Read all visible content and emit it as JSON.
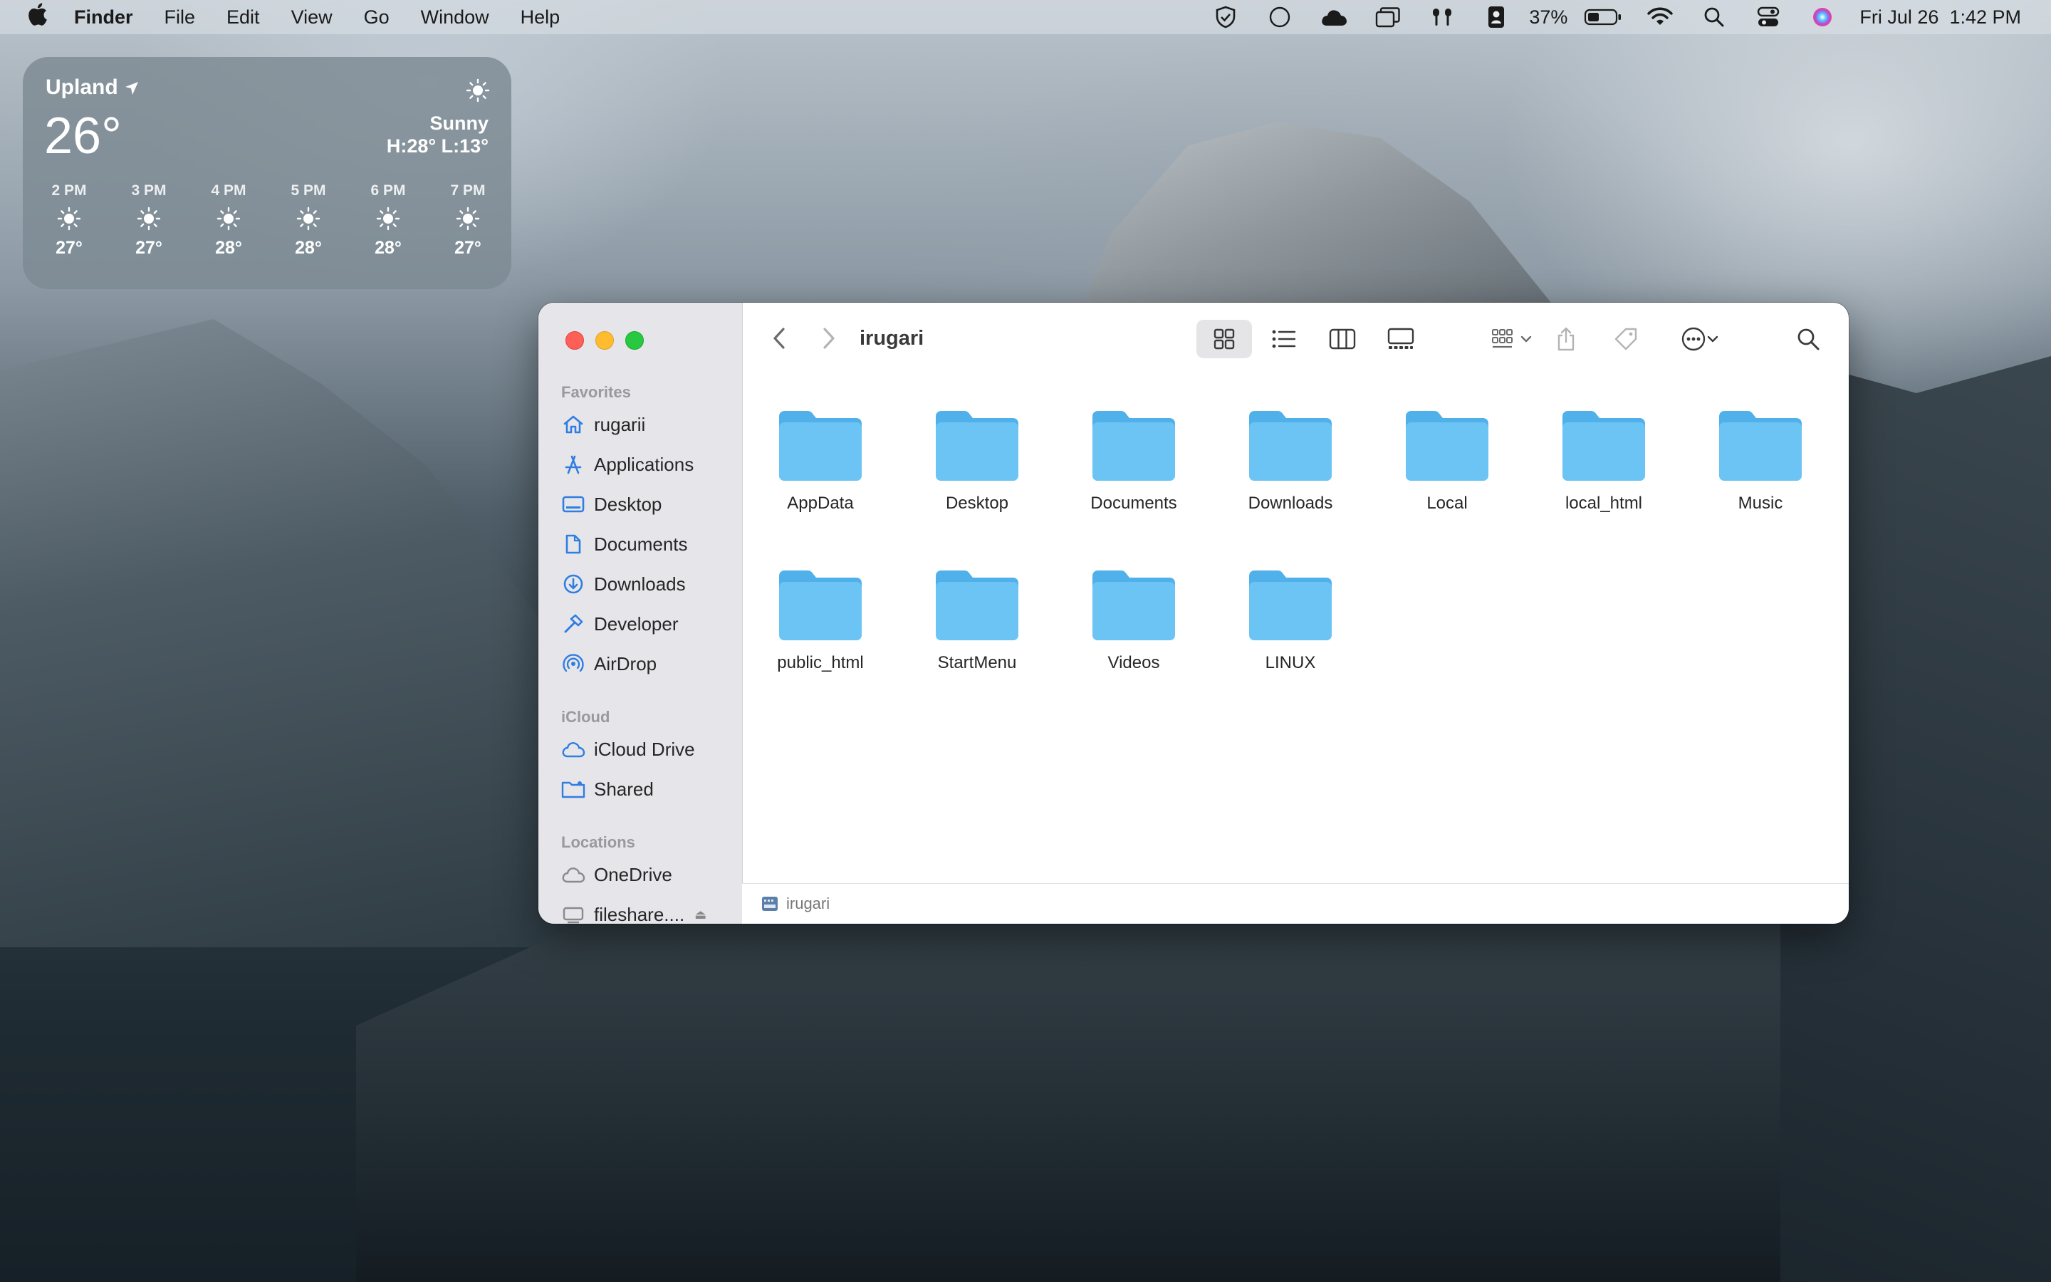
{
  "menubar": {
    "app": "Finder",
    "items": [
      "File",
      "Edit",
      "View",
      "Go",
      "Window",
      "Help"
    ],
    "battery": "37%",
    "datetime": "Fri Jul 26  1:42 PM"
  },
  "weather": {
    "city": "Upland",
    "temp": "26°",
    "condition": "Sunny",
    "high_low": "H:28° L:13°",
    "hours": [
      {
        "time": "2 PM",
        "temp": "27°"
      },
      {
        "time": "3 PM",
        "temp": "27°"
      },
      {
        "time": "4 PM",
        "temp": "28°"
      },
      {
        "time": "5 PM",
        "temp": "28°"
      },
      {
        "time": "6 PM",
        "temp": "28°"
      },
      {
        "time": "7 PM",
        "temp": "27°"
      }
    ]
  },
  "finder": {
    "title": "irugari",
    "sidebar": {
      "favorites_title": "Favorites",
      "favorites": [
        "rugarii",
        "Applications",
        "Desktop",
        "Documents",
        "Downloads",
        "Developer",
        "AirDrop"
      ],
      "icloud_title": "iCloud",
      "icloud": [
        "iCloud Drive",
        "Shared"
      ],
      "locations_title": "Locations",
      "locations": [
        "OneDrive",
        "fileshare...."
      ]
    },
    "folders": [
      "AppData",
      "Desktop",
      "Documents",
      "Downloads",
      "Local",
      "local_html",
      "Music",
      "public_html",
      "StartMenu",
      "Videos",
      "LINUX"
    ],
    "path": "irugari"
  },
  "colors": {
    "folder": "#6cc4f5",
    "folder_tab": "#4fb0ea",
    "sidebar_icon": "#2f7ee0"
  }
}
